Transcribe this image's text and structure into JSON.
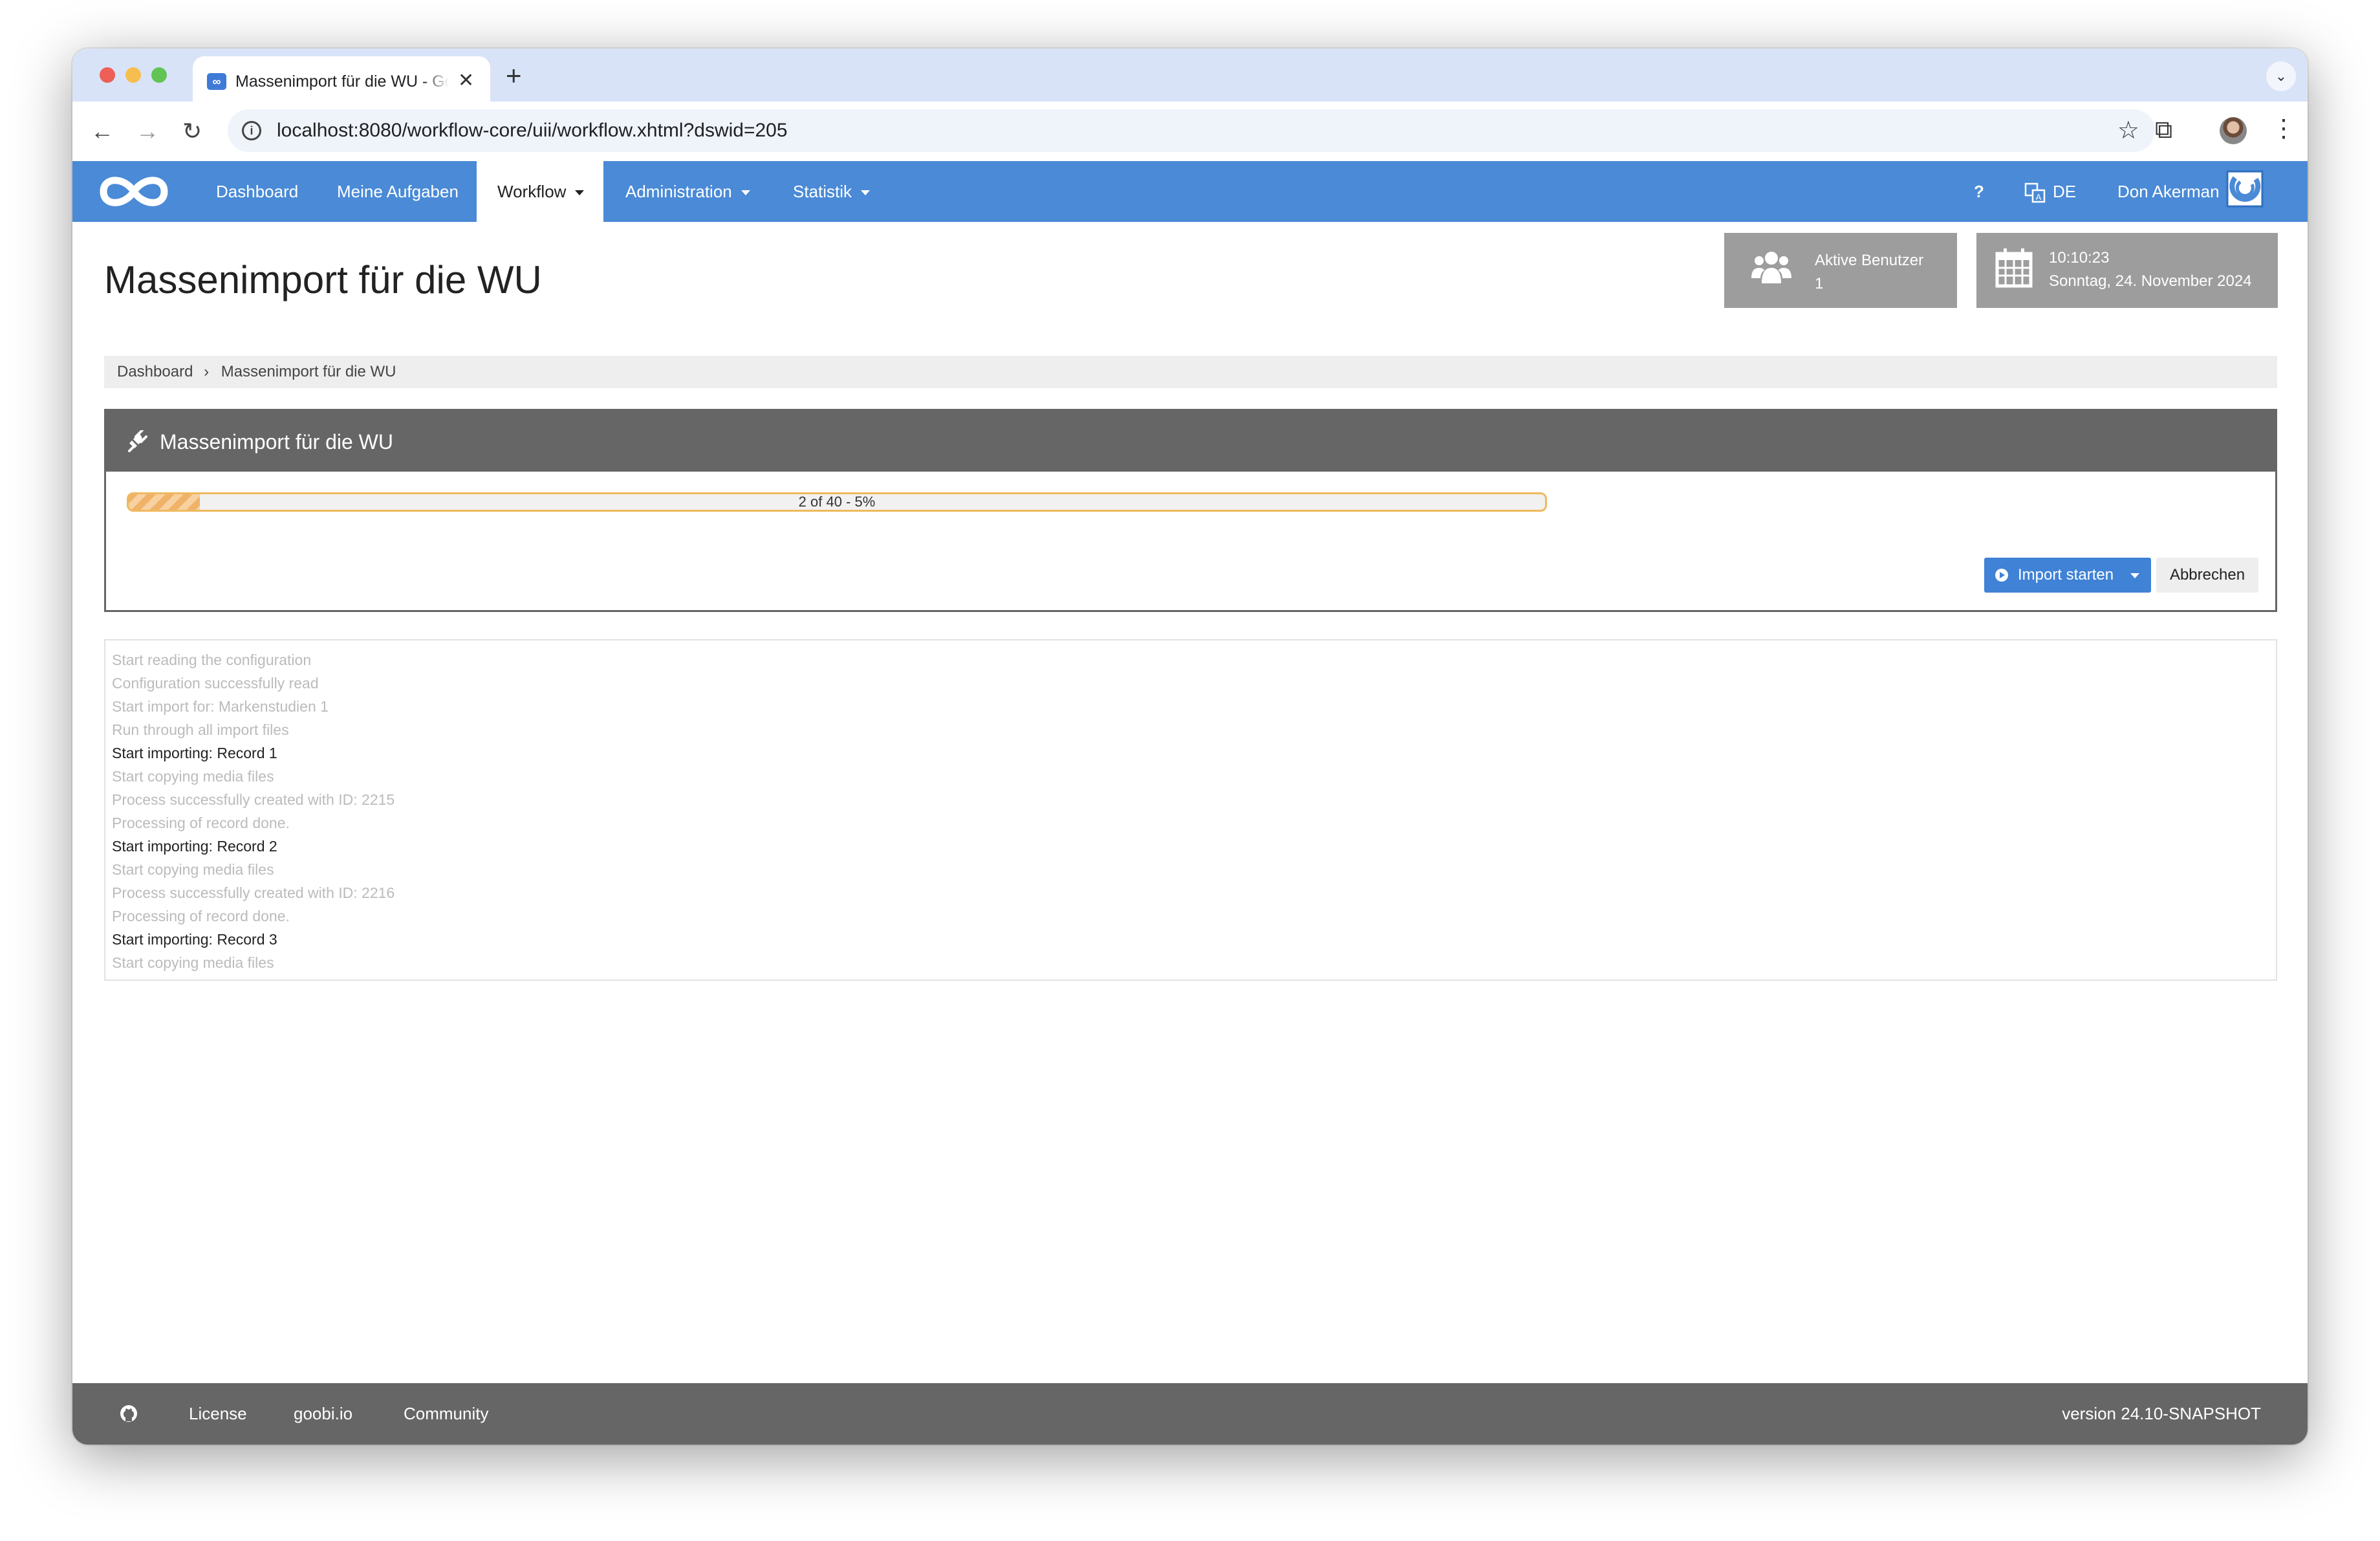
{
  "browser": {
    "tab_title": "Massenimport für die WU - Goobi workflow",
    "tab_close": "✕",
    "new_tab": "+",
    "url": "localhost:8080/workflow-core/uii/workflow.xhtml?dswid=205",
    "traffic_colors": [
      "#ee5f57",
      "#f5be4f",
      "#61c454"
    ]
  },
  "nav": {
    "items": [
      {
        "label": "Dashboard"
      },
      {
        "label": "Meine Aufgaben"
      },
      {
        "label": "Workflow",
        "active": true
      },
      {
        "label": "Administration"
      },
      {
        "label": "Statistik"
      }
    ],
    "help": "?",
    "language": "DE",
    "user": "Don Akerman",
    "accent_color": "#4a8ad6"
  },
  "header": {
    "title": "Massenimport für die WU",
    "active_users_label": "Aktive Benutzer",
    "active_users_count": "1",
    "time": "10:10:23",
    "date": "Sonntag, 24. November 2024"
  },
  "breadcrumb": {
    "items": [
      "Dashboard",
      "Massenimport für die WU"
    ],
    "separator": "›"
  },
  "panel": {
    "title": "Massenimport für die WU",
    "progress_text": "2 of 40 - 5%",
    "progress_percent": 5,
    "start_button": "Import starten",
    "cancel_button": "Abbrechen"
  },
  "log": [
    {
      "text": "Start reading the configuration",
      "emphasis": false
    },
    {
      "text": "Configuration successfully read",
      "emphasis": false
    },
    {
      "text": "Start import for: Markenstudien 1",
      "emphasis": false
    },
    {
      "text": "Run through all import files",
      "emphasis": false
    },
    {
      "text": "Start importing: Record 1",
      "emphasis": true
    },
    {
      "text": "Start copying media files",
      "emphasis": false
    },
    {
      "text": "Process successfully created with ID: 2215",
      "emphasis": false
    },
    {
      "text": "Processing of record done.",
      "emphasis": false
    },
    {
      "text": "Start importing: Record 2",
      "emphasis": true
    },
    {
      "text": "Start copying media files",
      "emphasis": false
    },
    {
      "text": "Process successfully created with ID: 2216",
      "emphasis": false
    },
    {
      "text": "Processing of record done.",
      "emphasis": false
    },
    {
      "text": "Start importing: Record 3",
      "emphasis": true
    },
    {
      "text": "Start copying media files",
      "emphasis": false
    }
  ],
  "footer": {
    "links": [
      "License",
      "goobi.io",
      "Community"
    ],
    "version": "version 24.10-SNAPSHOT"
  }
}
